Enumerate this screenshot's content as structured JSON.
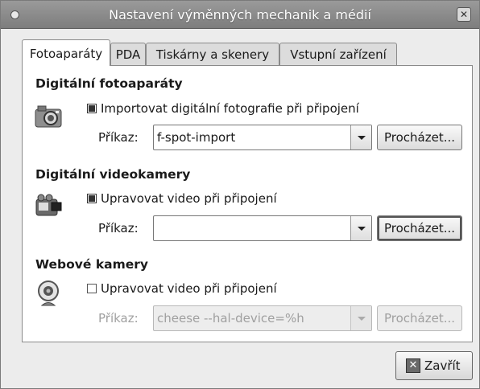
{
  "window": {
    "title": "Nastavení výměnných mechanik a médií"
  },
  "tabs": [
    {
      "label": "Fotoaparáty",
      "active": true
    },
    {
      "label": "PDA",
      "active": false
    },
    {
      "label": "Tiskárny a skenery",
      "active": false
    },
    {
      "label": "Vstupní zařízení",
      "active": false
    }
  ],
  "sections": {
    "camera": {
      "title": "Digitální fotoaparáty",
      "checkbox_label": "Importovat digitální fotografie při připojení",
      "checked": true,
      "command_label": "Příkaz:",
      "command_value": "f-spot-import",
      "browse_label": "Procházet..."
    },
    "video": {
      "title": "Digitální videokamery",
      "checkbox_label": "Upravovat video při připojení",
      "checked": true,
      "command_label": "Příkaz:",
      "command_value": "",
      "browse_label": "Procházet..."
    },
    "webcam": {
      "title": "Webové kamery",
      "checkbox_label": "Upravovat video při připojení",
      "checked": false,
      "command_label": "Příkaz:",
      "command_value": "cheese --hal-device=%h",
      "browse_label": "Procházet..."
    }
  },
  "footer": {
    "close_label": "Zavřít"
  }
}
